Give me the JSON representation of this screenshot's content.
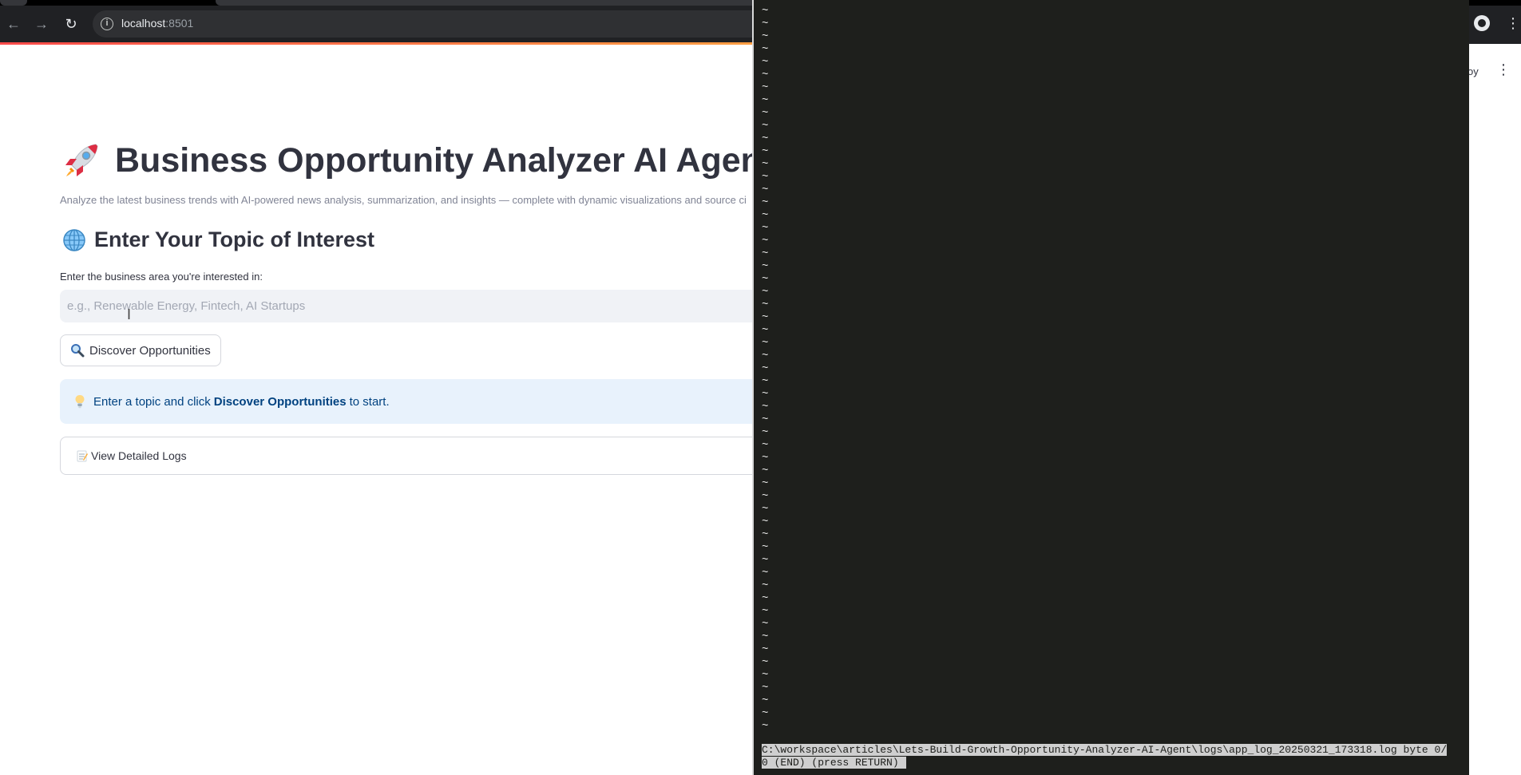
{
  "browser": {
    "url_host": "localhost",
    "url_port": ":8501"
  },
  "app": {
    "deploy_label": "oy",
    "title": "Business Opportunity Analyzer AI Agent",
    "subtitle": "Analyze the latest business trends with AI-powered news analysis, summarization, and insights — complete with dynamic visualizations and source ci",
    "section_heading": "Enter Your Topic of Interest",
    "input_label": "Enter the business area you're interested in:",
    "input_placeholder": "e.g., Renewable Energy, Fintech, AI Startups",
    "input_value": "",
    "discover_button_label": "Discover Opportunities",
    "info_prefix": "Enter a topic and click",
    "info_bold": "Discover Opportunities",
    "info_suffix": "to start.",
    "expander_label": "View Detailed Logs"
  },
  "terminal": {
    "status_line_1": "C:\\workspace\\articles\\Lets-Build-Growth-Opportunity-Analyzer-AI-Agent\\logs\\app_log_20250321_173318.log byte 0/",
    "status_line_2": "0 (END)  (press RETURN)"
  },
  "colors": {
    "accent_red": "#ff4b4b",
    "info_bg": "#e8f2fc",
    "info_text": "#004280",
    "terminal_bg": "#1e1f1c"
  },
  "icons": {
    "title": "rocket-icon",
    "section": "globe-icon",
    "button": "magnifier-icon",
    "info": "lightbulb-icon",
    "expander": "memo-icon"
  }
}
